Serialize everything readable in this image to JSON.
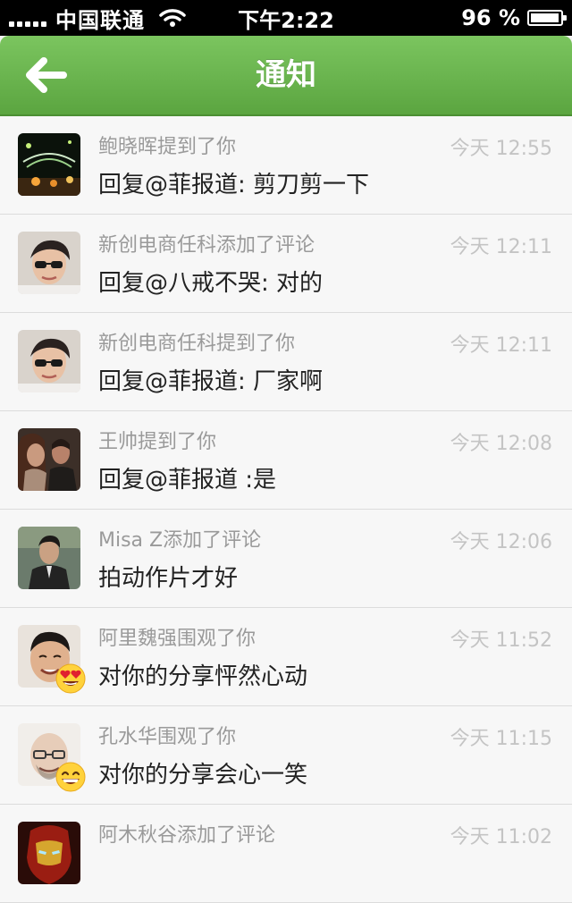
{
  "status_bar": {
    "carrier": "中国联通",
    "time": "下午2:22",
    "battery": "96 %",
    "battery_level": 0.96
  },
  "nav": {
    "title": "通知"
  },
  "notifications": [
    {
      "action": "鲍晓晖提到了你",
      "time": "今天 12:55",
      "content": "回复@菲报道: 剪刀剪一下",
      "avatar": "night-scene-avatar"
    },
    {
      "action": "新创电商任科添加了评论",
      "time": "今天 12:11",
      "content": "回复@八戒不哭: 对的",
      "avatar": "man-glasses-avatar"
    },
    {
      "action": "新创电商任科提到了你",
      "time": "今天 12:11",
      "content": "回复@菲报道: 厂家啊",
      "avatar": "man-glasses-avatar"
    },
    {
      "action": "王帅提到了你",
      "time": "今天 12:08",
      "content": "回复@菲报道 :是",
      "avatar": "couple-photo-avatar"
    },
    {
      "action": "Misa Z添加了评论",
      "time": "今天 12:06",
      "content": "拍动作片才好",
      "avatar": "man-suit-avatar"
    },
    {
      "action": "阿里魏强围观了你",
      "time": "今天 11:52",
      "content": "对你的分享怦然心动",
      "avatar": "smiling-man-avatar",
      "emoji": "heart-eyes-emoji"
    },
    {
      "action": "孔水华围观了你",
      "time": "今天 11:15",
      "content": "对你的分享会心一笑",
      "avatar": "bald-man-avatar",
      "emoji": "grin-emoji"
    },
    {
      "action": "阿木秋谷添加了评论",
      "time": "今天 11:02",
      "content": "",
      "avatar": "iron-man-avatar"
    }
  ]
}
